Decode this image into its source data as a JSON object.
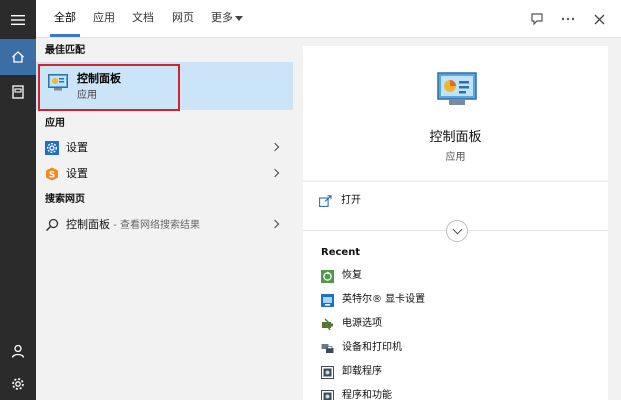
{
  "tabs": {
    "all": "全部",
    "apps": "应用",
    "documents": "文档",
    "web": "网页",
    "more": "更多"
  },
  "results": {
    "best_match_heading": "最佳匹配",
    "best_match": {
      "title": "控制面板",
      "subtitle": "应用"
    },
    "apps_heading": "应用",
    "apps": [
      {
        "label": "设置",
        "icon": "settings-gear-icon"
      },
      {
        "label": "设置",
        "icon": "settings-s-icon"
      }
    ],
    "web_heading": "搜索网页",
    "web_result": {
      "query": "控制面板",
      "suffix": " - 查看网络搜索结果"
    }
  },
  "preview": {
    "title": "控制面板",
    "subtitle": "应用",
    "open_label": "打开",
    "recent_heading": "Recent",
    "recent": [
      {
        "label": "恢复",
        "icon": "recovery-icon"
      },
      {
        "label": "英特尔® 显卡设置",
        "icon": "intel-graphics-icon"
      },
      {
        "label": "电源选项",
        "icon": "power-options-icon"
      },
      {
        "label": "设备和打印机",
        "icon": "devices-printers-icon"
      },
      {
        "label": "卸载程序",
        "icon": "uninstall-icon"
      },
      {
        "label": "程序和功能",
        "icon": "programs-features-icon"
      }
    ]
  },
  "colors": {
    "accent": "#3b78c8",
    "highlight": "#cce4f7",
    "annotation_border": "#d2222a",
    "rail": "#2b2b2b"
  }
}
